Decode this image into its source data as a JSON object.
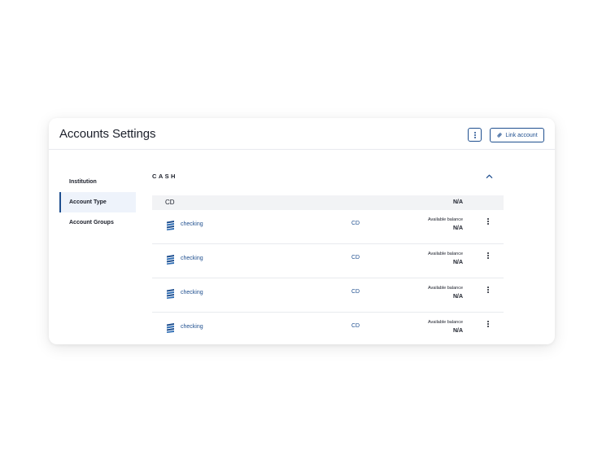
{
  "header": {
    "title": "Accounts Settings",
    "more_icon": "more-vertical-icon",
    "link_icon": "link-icon",
    "link_label": "Link account"
  },
  "sidebar": {
    "items": [
      {
        "label": "Institution",
        "active": false
      },
      {
        "label": "Account Type",
        "active": true
      },
      {
        "label": "Account Groups",
        "active": false
      }
    ]
  },
  "section": {
    "title": "CASH",
    "collapse_icon": "chevron-up-icon",
    "group": {
      "name": "CD",
      "value": "N/A"
    },
    "accounts": [
      {
        "icon": "bank-icon",
        "name": "checking",
        "type": "CD",
        "balance_label": "Available balance",
        "balance": "N/A"
      },
      {
        "icon": "bank-icon",
        "name": "checking",
        "type": "CD",
        "balance_label": "Available balance",
        "balance": "N/A"
      },
      {
        "icon": "bank-icon",
        "name": "checking",
        "type": "CD",
        "balance_label": "Available balance",
        "balance": "N/A"
      },
      {
        "icon": "bank-icon",
        "name": "checking",
        "type": "CD",
        "balance_label": "Available balance",
        "balance": "N/A"
      }
    ]
  },
  "colors": {
    "accent": "#1f4f8f",
    "active_bg": "#eef3fb",
    "group_bg": "#f2f3f5"
  }
}
